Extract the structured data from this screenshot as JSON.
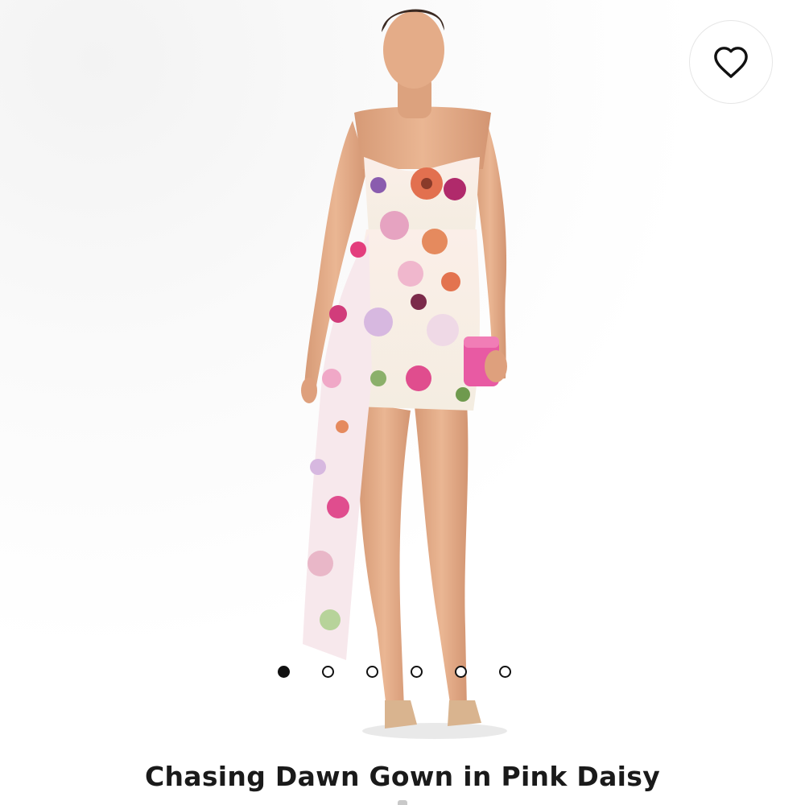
{
  "product": {
    "title": "Chasing Dawn Gown in Pink Daisy"
  },
  "wishlist": {
    "icon": "heart-outline-icon"
  },
  "carousel": {
    "total": 6,
    "active_index": 0
  },
  "colors": {
    "title": "#1a1a1a",
    "dot_active": "#111111",
    "clutch_pink": "#e85aa3"
  }
}
